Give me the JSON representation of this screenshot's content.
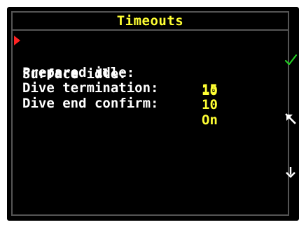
{
  "header": {
    "title": "Timeouts"
  },
  "menu": {
    "items": [
      {
        "label": "Surface idle:",
        "value": "10"
      },
      {
        "label": "Prepared idle:",
        "value": "15"
      },
      {
        "label": "Dive termination:",
        "value": "10"
      },
      {
        "label": "Dive end confirm:",
        "value": "On"
      }
    ],
    "selected_index": 0
  },
  "side_buttons": [
    {
      "name": "confirm",
      "icon": "checkmark-icon",
      "color": "#22cc22"
    },
    {
      "name": "back",
      "icon": "arrow-up-left-icon",
      "color": "#ffffff"
    },
    {
      "name": "next",
      "icon": "arrow-down-icon",
      "color": "#ffffff"
    }
  ],
  "colors": {
    "title": "#ffff33",
    "label": "#ffffff",
    "value": "#ffff33",
    "cursor": "#ff2222",
    "confirm": "#22cc22"
  }
}
